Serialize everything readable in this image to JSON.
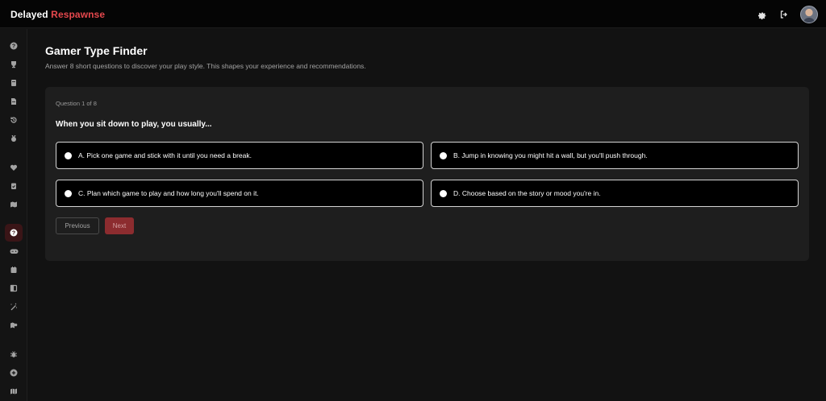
{
  "app": {
    "brand_main": "Delayed",
    "brand_accent": "Respawnse",
    "accent_color": "#e5484d"
  },
  "header": {
    "icons": [
      "gear-icon",
      "logout-icon",
      "avatar"
    ]
  },
  "sidebar": {
    "items": [
      {
        "icon": "help-circle-icon"
      },
      {
        "icon": "trophy-icon"
      },
      {
        "icon": "book-icon"
      },
      {
        "icon": "document-icon"
      },
      {
        "icon": "history-icon"
      },
      {
        "icon": "badge-icon"
      },
      {
        "icon": "heart-icon"
      },
      {
        "icon": "clipboard-check-icon"
      },
      {
        "icon": "map-icon"
      },
      {
        "icon": "question-icon",
        "active": true
      },
      {
        "icon": "gamepad-icon"
      },
      {
        "icon": "calendar-icon"
      },
      {
        "icon": "panel-icon"
      },
      {
        "icon": "wand-icon"
      },
      {
        "icon": "map-pin-icon"
      },
      {
        "icon": "bug-icon"
      },
      {
        "icon": "plus-circle-icon"
      },
      {
        "icon": "map-folded-icon"
      }
    ]
  },
  "page": {
    "title": "Gamer Type Finder",
    "subtitle": "Answer 8 short questions to discover your play style. This shapes your experience and recommendations."
  },
  "quiz": {
    "progress": "Question 1 of 8",
    "question": "When you sit down to play, you usually...",
    "options": [
      "A. Pick one game and stick with it until you need a break.",
      "B. Jump in knowing you might hit a wall, but you'll push through.",
      "C. Plan which game to play and how long you'll spend on it.",
      "D. Choose based on the story or mood you're in."
    ],
    "prev_label": "Previous",
    "next_label": "Next"
  }
}
